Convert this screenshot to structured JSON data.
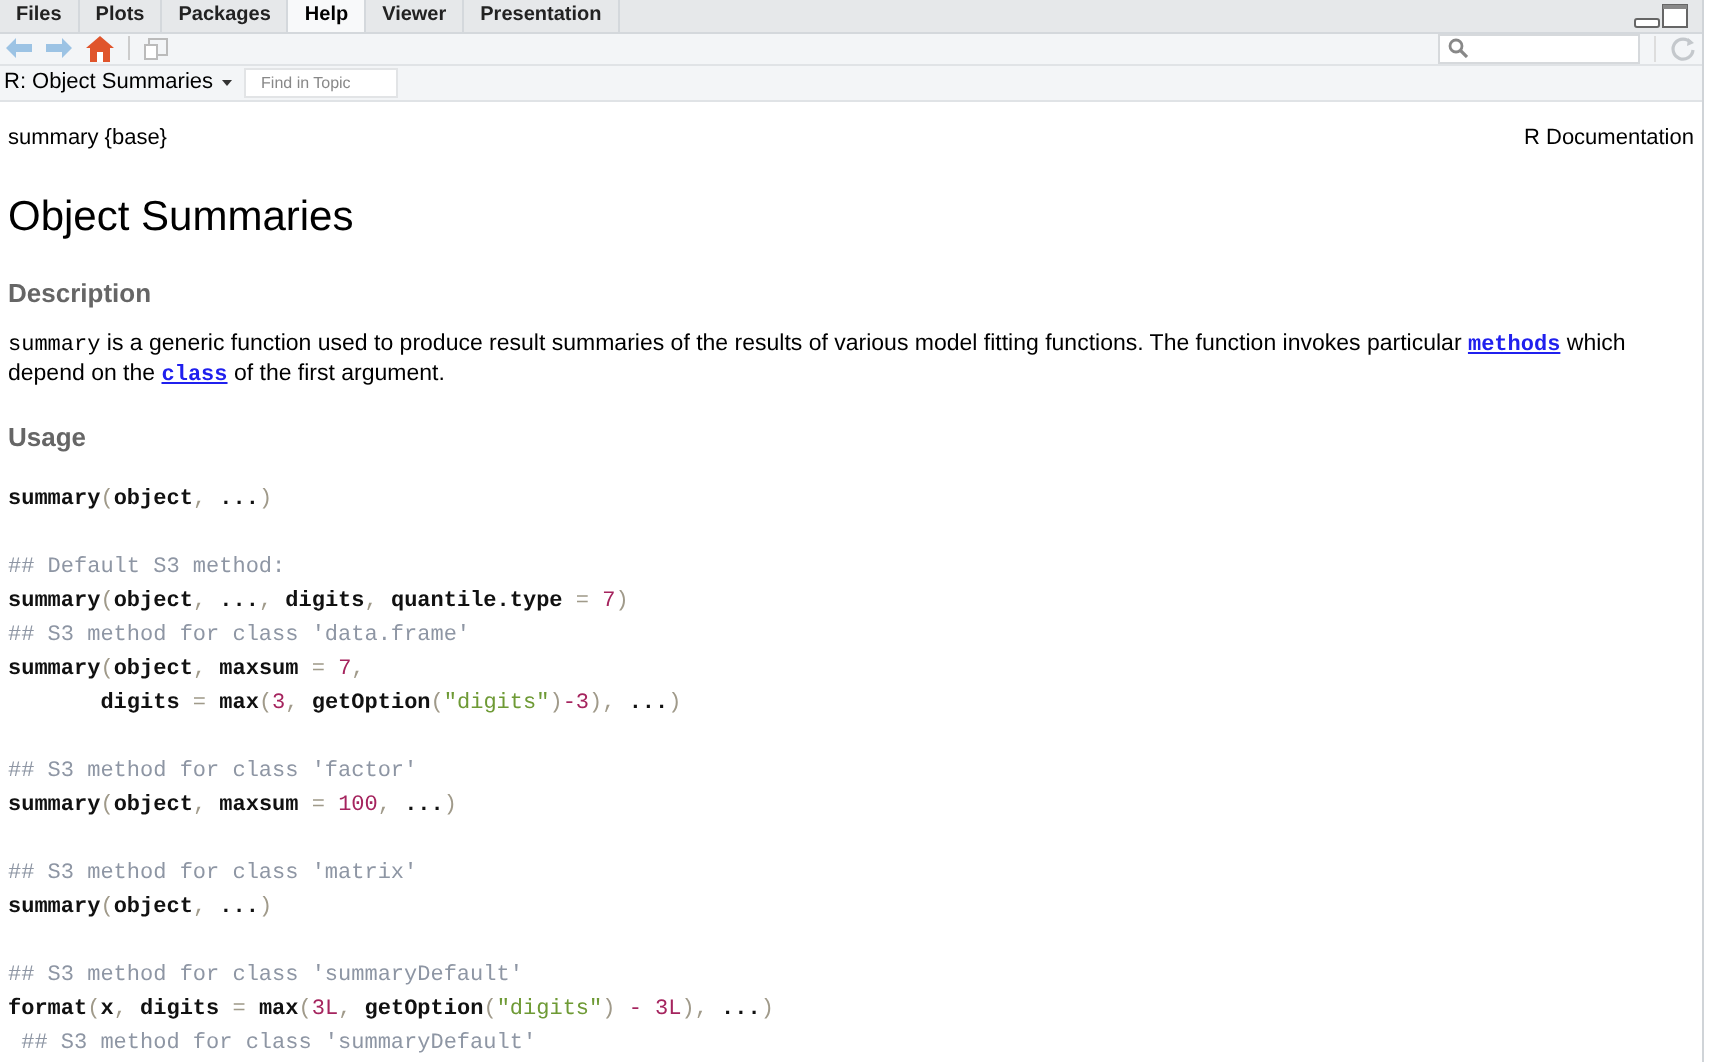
{
  "tabs": [
    {
      "label": "Files",
      "selected": false
    },
    {
      "label": "Plots",
      "selected": false
    },
    {
      "label": "Packages",
      "selected": false
    },
    {
      "label": "Help",
      "selected": true
    },
    {
      "label": "Viewer",
      "selected": false
    },
    {
      "label": "Presentation",
      "selected": false
    }
  ],
  "topic": {
    "title": "R: Object Summaries",
    "find_placeholder": "Find in Topic"
  },
  "doc": {
    "header_left": "summary {base}",
    "header_right": "R Documentation",
    "title": "Object Summaries",
    "sections": [
      {
        "heading": "Description",
        "kind": "text",
        "parts": [
          {
            "kind": "code",
            "text": "summary"
          },
          {
            "kind": "plain",
            "text": " is a generic function used to produce result summaries of the results of various model fitting functions. The function invokes particular "
          },
          {
            "kind": "link",
            "text": "methods"
          },
          {
            "kind": "plain",
            "text": " which depend on the "
          },
          {
            "kind": "link",
            "text": "class"
          },
          {
            "kind": "plain",
            "text": " of the first argument."
          }
        ]
      },
      {
        "heading": "Usage",
        "kind": "code",
        "blocks": [
          {
            "lines": [
              {
                "tokens": [
                  {
                    "kind": "fn",
                    "text": "summary"
                  },
                  {
                    "kind": "punct",
                    "text": "("
                  },
                  {
                    "kind": "fn",
                    "text": "object"
                  },
                  {
                    "kind": "punct",
                    "text": ", "
                  },
                  {
                    "kind": "fn",
                    "text": "..."
                  },
                  {
                    "kind": "punct",
                    "text": ")"
                  }
                ]
              }
            ]
          },
          {
            "lines": [
              {
                "tokens": [
                  {
                    "kind": "comment",
                    "text": "## Default S3 method:"
                  }
                ]
              },
              {
                "tokens": [
                  {
                    "kind": "fn",
                    "text": "summary"
                  },
                  {
                    "kind": "punct",
                    "text": "("
                  },
                  {
                    "kind": "fn",
                    "text": "object"
                  },
                  {
                    "kind": "punct",
                    "text": ", "
                  },
                  {
                    "kind": "fn",
                    "text": "..."
                  },
                  {
                    "kind": "punct",
                    "text": ", "
                  },
                  {
                    "kind": "fn",
                    "text": "digits"
                  },
                  {
                    "kind": "punct",
                    "text": ", "
                  },
                  {
                    "kind": "fn",
                    "text": "quantile.type "
                  },
                  {
                    "kind": "punct",
                    "text": "= "
                  },
                  {
                    "kind": "num",
                    "text": "7"
                  },
                  {
                    "kind": "punct",
                    "text": ")"
                  }
                ]
              },
              {
                "tokens": [
                  {
                    "kind": "comment",
                    "text": "## S3 method for class 'data.frame'"
                  }
                ]
              },
              {
                "tokens": [
                  {
                    "kind": "fn",
                    "text": "summary"
                  },
                  {
                    "kind": "punct",
                    "text": "("
                  },
                  {
                    "kind": "fn",
                    "text": "object"
                  },
                  {
                    "kind": "punct",
                    "text": ", "
                  },
                  {
                    "kind": "fn",
                    "text": "maxsum "
                  },
                  {
                    "kind": "punct",
                    "text": "= "
                  },
                  {
                    "kind": "num",
                    "text": "7"
                  },
                  {
                    "kind": "punct",
                    "text": ","
                  }
                ]
              },
              {
                "tokens": [
                  {
                    "kind": "fn",
                    "text": "       digits "
                  },
                  {
                    "kind": "punct",
                    "text": "= "
                  },
                  {
                    "kind": "fn",
                    "text": "max"
                  },
                  {
                    "kind": "punct",
                    "text": "("
                  },
                  {
                    "kind": "num",
                    "text": "3"
                  },
                  {
                    "kind": "punct",
                    "text": ", "
                  },
                  {
                    "kind": "fn",
                    "text": "getOption"
                  },
                  {
                    "kind": "punct",
                    "text": "("
                  },
                  {
                    "kind": "str",
                    "text": "\"digits\""
                  },
                  {
                    "kind": "punct",
                    "text": ")"
                  },
                  {
                    "kind": "num",
                    "text": "-3"
                  },
                  {
                    "kind": "punct",
                    "text": "), "
                  },
                  {
                    "kind": "fn",
                    "text": "..."
                  },
                  {
                    "kind": "punct",
                    "text": ")"
                  }
                ]
              }
            ]
          },
          {
            "lines": [
              {
                "tokens": [
                  {
                    "kind": "comment",
                    "text": "## S3 method for class 'factor'"
                  }
                ]
              },
              {
                "tokens": [
                  {
                    "kind": "fn",
                    "text": "summary"
                  },
                  {
                    "kind": "punct",
                    "text": "("
                  },
                  {
                    "kind": "fn",
                    "text": "object"
                  },
                  {
                    "kind": "punct",
                    "text": ", "
                  },
                  {
                    "kind": "fn",
                    "text": "maxsum "
                  },
                  {
                    "kind": "punct",
                    "text": "= "
                  },
                  {
                    "kind": "num",
                    "text": "100"
                  },
                  {
                    "kind": "punct",
                    "text": ", "
                  },
                  {
                    "kind": "fn",
                    "text": "..."
                  },
                  {
                    "kind": "punct",
                    "text": ")"
                  }
                ]
              }
            ]
          },
          {
            "lines": [
              {
                "tokens": [
                  {
                    "kind": "comment",
                    "text": "## S3 method for class 'matrix'"
                  }
                ]
              },
              {
                "tokens": [
                  {
                    "kind": "fn",
                    "text": "summary"
                  },
                  {
                    "kind": "punct",
                    "text": "("
                  },
                  {
                    "kind": "fn",
                    "text": "object"
                  },
                  {
                    "kind": "punct",
                    "text": ", "
                  },
                  {
                    "kind": "fn",
                    "text": "..."
                  },
                  {
                    "kind": "punct",
                    "text": ")"
                  }
                ]
              }
            ]
          },
          {
            "lines": [
              {
                "tokens": [
                  {
                    "kind": "comment",
                    "text": "## S3 method for class 'summaryDefault'"
                  }
                ]
              },
              {
                "tokens": [
                  {
                    "kind": "fn",
                    "text": "format"
                  },
                  {
                    "kind": "punct",
                    "text": "("
                  },
                  {
                    "kind": "fn",
                    "text": "x"
                  },
                  {
                    "kind": "punct",
                    "text": ", "
                  },
                  {
                    "kind": "fn",
                    "text": "digits "
                  },
                  {
                    "kind": "punct",
                    "text": "= "
                  },
                  {
                    "kind": "fn",
                    "text": "max"
                  },
                  {
                    "kind": "punct",
                    "text": "("
                  },
                  {
                    "kind": "num",
                    "text": "3L"
                  },
                  {
                    "kind": "punct",
                    "text": ", "
                  },
                  {
                    "kind": "fn",
                    "text": "getOption"
                  },
                  {
                    "kind": "punct",
                    "text": "("
                  },
                  {
                    "kind": "str",
                    "text": "\"digits\""
                  },
                  {
                    "kind": "punct",
                    "text": ") "
                  },
                  {
                    "kind": "num",
                    "text": "- 3L"
                  },
                  {
                    "kind": "punct",
                    "text": "), "
                  },
                  {
                    "kind": "fn",
                    "text": "..."
                  },
                  {
                    "kind": "punct",
                    "text": ")"
                  }
                ]
              },
              {
                "tokens": [
                  {
                    "kind": "comment",
                    "text": " ## S3 method for class 'summaryDefault'"
                  }
                ]
              }
            ]
          }
        ]
      }
    ]
  }
}
